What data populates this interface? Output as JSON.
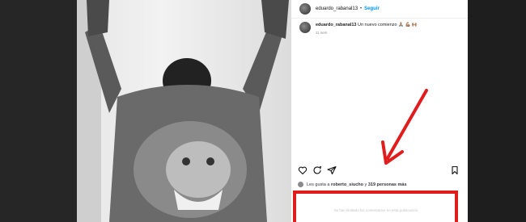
{
  "post": {
    "username": "eduardo_rabanal13",
    "separator": "•",
    "follow_label": "Seguir",
    "caption_user": "eduardo_rabanal13",
    "caption_text": "Un nuevo comienzo 🙏🏽 💪🏽 🙌🏽",
    "time": "11 sem",
    "likes_prefix": "Les gusta a",
    "likes_user": "roberto_siucho",
    "likes_connector": "y",
    "likes_count": "319 personas más",
    "comments_limited": "Se han limitado los comentarios en esta publicación."
  },
  "icons": {
    "like": "heart-icon",
    "comment": "comment-icon",
    "share": "share-icon",
    "save": "bookmark-icon"
  },
  "colors": {
    "follow": "#0095f6",
    "highlight": "#e01c1c"
  }
}
